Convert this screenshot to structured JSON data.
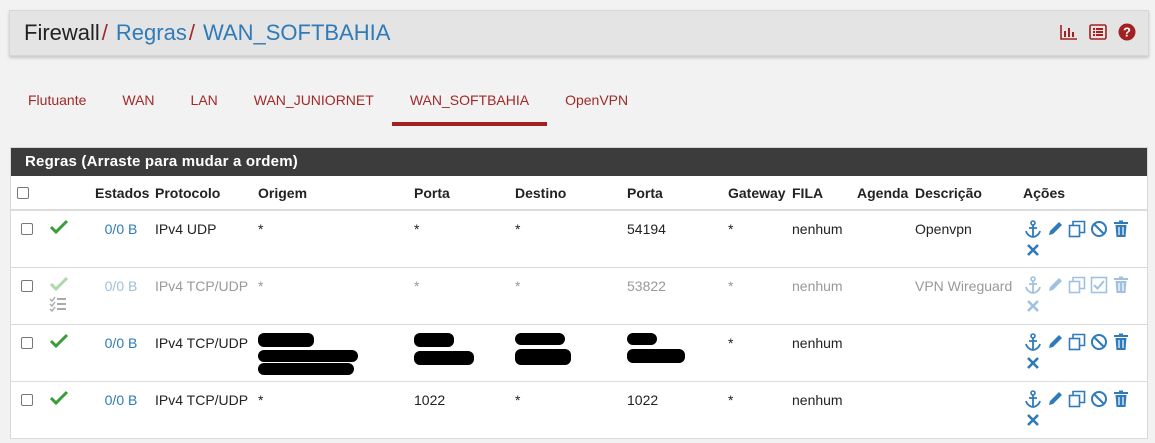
{
  "breadcrumb": {
    "root": "Firewall",
    "sep": "/",
    "level1": "Regras",
    "level2": "WAN_SOFTBAHIA"
  },
  "header_icons": [
    "chart-icon",
    "list-icon",
    "help-icon"
  ],
  "tabs": [
    {
      "label": "Flutuante"
    },
    {
      "label": "WAN"
    },
    {
      "label": "LAN"
    },
    {
      "label": "WAN_JUNIORNET"
    },
    {
      "label": "WAN_SOFTBAHIA",
      "active": true
    },
    {
      "label": "OpenVPN"
    }
  ],
  "panel": {
    "title": "Regras (Arraste para mudar a ordem)"
  },
  "columns": {
    "estados": "Estados",
    "protocolo": "Protocolo",
    "origem": "Origem",
    "porta": "Porta",
    "destino": "Destino",
    "porta2": "Porta",
    "gateway": "Gateway",
    "fila": "FILA",
    "agenda": "Agenda",
    "descricao": "Descrição",
    "acoes": "Ações"
  },
  "rows": [
    {
      "estados": "0/0 B",
      "protocolo": "IPv4 UDP",
      "origem": "*",
      "porta": "*",
      "destino": "*",
      "porta2": "54194",
      "gateway": "*",
      "fila": "nenhum",
      "agenda": "",
      "descricao": "Openvpn",
      "enabled": true
    },
    {
      "estados": "0/0 B",
      "protocolo": "IPv4 TCP/UDP",
      "origem": "*",
      "porta": "*",
      "destino": "*",
      "porta2": "53822",
      "gateway": "*",
      "fila": "nenhum",
      "agenda": "",
      "descricao": "VPN Wireguard",
      "enabled": false
    },
    {
      "estados": "0/0 B",
      "protocolo": "IPv4 TCP/UDP",
      "origem": "",
      "porta": "",
      "destino": "",
      "porta2": "",
      "gateway": "*",
      "fila": "nenhum",
      "agenda": "",
      "descricao": "",
      "enabled": true,
      "redacted": true
    },
    {
      "estados": "0/0 B",
      "protocolo": "IPv4 TCP/UDP",
      "origem": "*",
      "porta": "1022",
      "destino": "*",
      "porta2": "1022",
      "gateway": "*",
      "fila": "nenhum",
      "agenda": "",
      "descricao": "",
      "enabled": true
    }
  ],
  "colors": {
    "accent": "#a32020",
    "link": "#2f7ab8",
    "success": "#3a9d3a",
    "header_bg": "#3c3c3c"
  }
}
